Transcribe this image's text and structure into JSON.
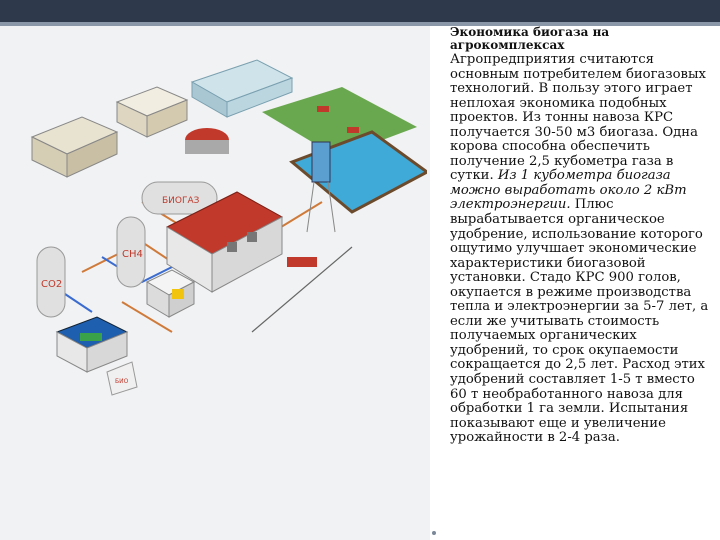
{
  "slide": {
    "title": "Экономика биогаза на агрокомплексах",
    "body_part1": "Агропредприятия считаются основным потребителем биогазовых технологий. В пользу этого играет неплохая экономика подобных проектов. Из тонны навоза КРС получается 30-50 м3 биогаза. Одна корова способна обеспечить получение 2,5 кубометра газа в сутки. ",
    "body_italic": "Из 1 кубометра биогаза можно выработать около 2 кВт электроэнергии.",
    "body_part2": " Плюс вырабатывается органическое удобрение, использование которого ощутимо улучшает экономические характеристики биогазовой установки. Стадо КРС 900 голов, окупается в режиме производства тепла и электроэнергии за 5-7 лет, а если же учитывать стоимость получаемых органических удобрений, то срок окупаемости сокращается до 2,5 лет. Расход этих удобрений составляет 1-5 т вместо 60 т необработанного навоза для обработки 1 га земли. Испытания показывают еще и увеличение урожайности в 2-4 раза."
  },
  "illustration": {
    "tank_labels": [
      "БИОГАЗ",
      "CH4",
      "CO2"
    ],
    "bag_label": "БИО"
  },
  "colors": {
    "topbar": "#2e3a4c",
    "accent": "#8a97a8",
    "panel": "#f1f2f3"
  }
}
